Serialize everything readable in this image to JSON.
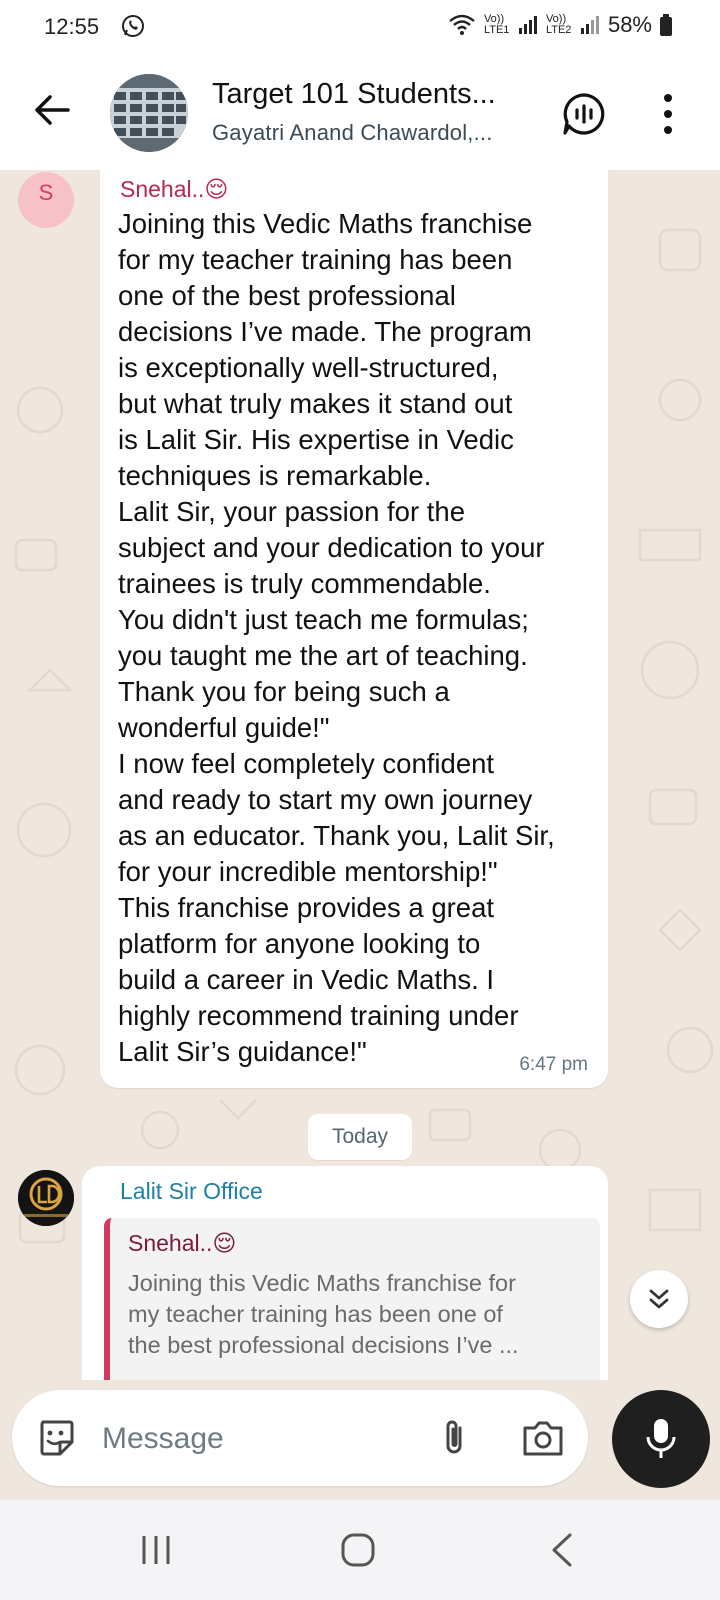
{
  "status_bar": {
    "time": "12:55",
    "network_1": "Vo)) LTE1",
    "network_2": "Vo)) LTE2",
    "battery": "58%"
  },
  "header": {
    "title": "Target 101 Students...",
    "subtitle": "Gayatri Anand Chawardol,..."
  },
  "messages": [
    {
      "avatar_letter": "S",
      "sender": "Snehal..😌",
      "text": "Joining this Vedic Maths franchise\nfor my teacher training has been\none of the best professional\ndecisions I’ve made. The program\nis exceptionally well-structured,\nbut what truly makes it stand out\nis Lalit Sir. His expertise in Vedic\ntechniques is remarkable.\nLalit Sir, your passion for the\nsubject and your dedication to your\ntrainees is truly commendable.\nYou didn't just teach me formulas;\nyou taught me the art of teaching.\nThank you for being such a\nwonderful guide!\"\nI now feel completely confident\nand ready to start my own journey\nas an educator. Thank you, Lalit Sir,\nfor your incredible mentorship!\"\nThis franchise provides a great\nplatform for anyone looking to\nbuild a career in Vedic Maths. I\nhighly recommend training under\nLalit Sir’s guidance!\"",
      "time": "6:47 pm"
    }
  ],
  "date_divider": "Today",
  "reply_message": {
    "sender": "Lalit Sir Office",
    "avatar_text": "LALIT DANDRE",
    "quoted_sender": "Snehal..😌",
    "quoted_text": "Joining this Vedic Maths franchise for\nmy teacher training has been one of\nthe best professional decisions I’ve ..."
  },
  "composer": {
    "placeholder": "Message"
  },
  "colors": {
    "chat_background": "#efe7dd",
    "sender_name": "#b5294e",
    "office_name": "#1c7fa6",
    "quote_bar": "#d6355c"
  },
  "icons": [
    "whatsapp-status-icon",
    "wifi-icon",
    "signal-icon",
    "battery-icon",
    "back-arrow-icon",
    "voice-chat-icon",
    "more-vert-icon",
    "sticker-icon",
    "attach-icon",
    "camera-icon",
    "mic-icon",
    "chevrons-down-icon",
    "recents-icon",
    "home-icon",
    "nav-back-icon"
  ]
}
